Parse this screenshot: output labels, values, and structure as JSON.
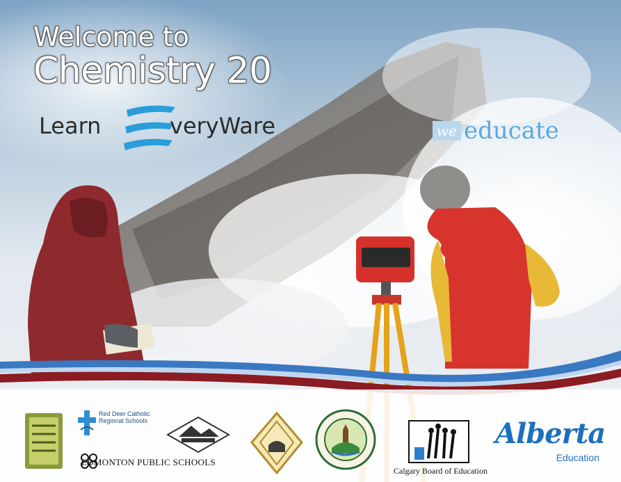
{
  "title": {
    "line1": "Welcome to",
    "line2": "Chemistry 20"
  },
  "learn_logo": {
    "part1": "Learn",
    "part2": "veryWare"
  },
  "we_educate": {
    "we": "we",
    "educate": "educate"
  },
  "partners": {
    "red_deer": {
      "line1": "Red Deer Catholic",
      "line2": "Regional Schools"
    },
    "edmonton": "EDMONTON PUBLIC SCHOOLS",
    "calgary": "Calgary Board of Education",
    "alberta": {
      "name": "Alberta",
      "sub": "Education"
    }
  },
  "colors": {
    "accent_blue": "#1d6fbf",
    "swoosh_red": "#8a1c22",
    "swoosh_blue": "#3a78c2"
  }
}
